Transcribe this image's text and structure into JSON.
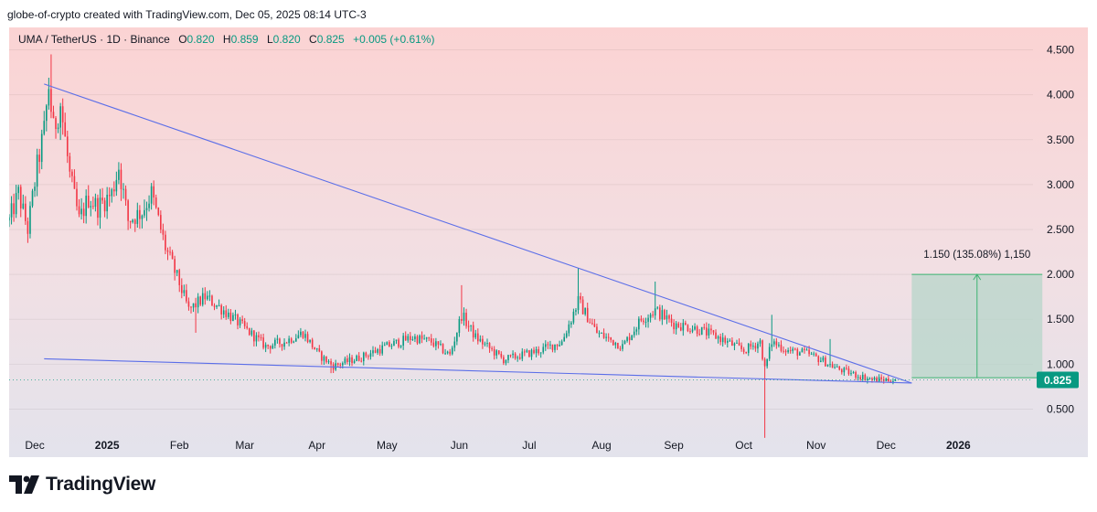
{
  "header": {
    "credit": "globe-of-crypto created with TradingView.com, Dec 05, 2025 08:14 UTC-3"
  },
  "legend": {
    "symbol": "UMA / TetherUS · 1D · Binance",
    "o_label": "O",
    "o_value": "0.820",
    "h_label": "H",
    "h_value": "0.859",
    "l_label": "L",
    "l_value": "0.820",
    "c_label": "C",
    "c_value": "0.825",
    "change": "+0.005 (+0.61%)"
  },
  "price_tag": "0.825",
  "measure_label": "1.150 (135.08%) 1,150",
  "brand": {
    "name": "TradingView"
  },
  "colors": {
    "up": "#089981",
    "down": "#f23645",
    "trendline": "#5b6ee8",
    "projection_fill": "#b7d6c9",
    "projection_stroke": "#3cb371"
  },
  "chart_data": {
    "type": "candlestick",
    "symbol": "UMA / TetherUS",
    "interval": "1D",
    "exchange": "Binance",
    "y_ticks": [
      "4.500",
      "4.000",
      "3.500",
      "3.000",
      "2.500",
      "2.000",
      "1.500",
      "1.000",
      "0.500"
    ],
    "ylim": [
      0.25,
      4.75
    ],
    "x_ticks": [
      "Dec",
      "2025",
      "Feb",
      "Mar",
      "Apr",
      "May",
      "Jun",
      "Jul",
      "Aug",
      "Sep",
      "Oct",
      "Nov",
      "Dec",
      "2026"
    ],
    "x_start": "2024-11-20",
    "x_end": "2026-02-02",
    "last_price": 0.825,
    "price_path": [
      [
        "2024-11-20",
        2.6
      ],
      [
        "2024-11-24",
        2.9
      ],
      [
        "2024-11-28",
        2.5
      ],
      [
        "2024-12-02",
        3.2
      ],
      [
        "2024-12-05",
        3.6
      ],
      [
        "2024-12-07",
        4.1
      ],
      [
        "2024-12-09",
        3.6
      ],
      [
        "2024-12-12",
        3.9
      ],
      [
        "2024-12-16",
        3.1
      ],
      [
        "2024-12-20",
        2.6
      ],
      [
        "2024-12-24",
        2.85
      ],
      [
        "2024-12-28",
        2.75
      ],
      [
        "2025-01-03",
        2.9
      ],
      [
        "2025-01-06",
        3.2
      ],
      [
        "2025-01-10",
        2.6
      ],
      [
        "2025-01-16",
        2.7
      ],
      [
        "2025-01-20",
        2.9
      ],
      [
        "2025-01-26",
        2.3
      ],
      [
        "2025-02-01",
        1.9
      ],
      [
        "2025-02-05",
        1.6
      ],
      [
        "2025-02-12",
        1.75
      ],
      [
        "2025-02-20",
        1.6
      ],
      [
        "2025-03-01",
        1.4
      ],
      [
        "2025-03-10",
        1.2
      ],
      [
        "2025-03-18",
        1.25
      ],
      [
        "2025-03-26",
        1.35
      ],
      [
        "2025-04-02",
        1.1
      ],
      [
        "2025-04-08",
        0.98
      ],
      [
        "2025-04-20",
        1.08
      ],
      [
        "2025-05-01",
        1.2
      ],
      [
        "2025-05-12",
        1.3
      ],
      [
        "2025-05-20",
        1.25
      ],
      [
        "2025-05-28",
        1.1
      ],
      [
        "2025-06-02",
        1.55
      ],
      [
        "2025-06-08",
        1.3
      ],
      [
        "2025-06-20",
        1.05
      ],
      [
        "2025-07-05",
        1.15
      ],
      [
        "2025-07-15",
        1.25
      ],
      [
        "2025-07-22",
        1.7
      ],
      [
        "2025-07-30",
        1.35
      ],
      [
        "2025-08-10",
        1.2
      ],
      [
        "2025-08-18",
        1.5
      ],
      [
        "2025-08-24",
        1.6
      ],
      [
        "2025-09-01",
        1.45
      ],
      [
        "2025-09-10",
        1.4
      ],
      [
        "2025-09-20",
        1.3
      ],
      [
        "2025-10-01",
        1.15
      ],
      [
        "2025-10-08",
        1.25
      ],
      [
        "2025-10-10",
        0.95
      ],
      [
        "2025-10-13",
        1.25
      ],
      [
        "2025-10-20",
        1.15
      ],
      [
        "2025-10-28",
        1.12
      ],
      [
        "2025-11-03",
        1.05
      ],
      [
        "2025-11-10",
        0.95
      ],
      [
        "2025-11-18",
        0.88
      ],
      [
        "2025-11-25",
        0.83
      ],
      [
        "2025-12-05",
        0.825
      ]
    ],
    "candle_highs": [
      [
        "2024-12-08",
        4.45
      ],
      [
        "2025-01-06",
        3.25
      ],
      [
        "2025-06-02",
        1.88
      ],
      [
        "2025-07-22",
        2.07
      ],
      [
        "2025-08-24",
        1.92
      ],
      [
        "2025-10-13",
        1.55
      ],
      [
        "2025-11-07",
        1.28
      ]
    ],
    "candle_lows": [
      [
        "2025-02-08",
        1.35
      ],
      [
        "2025-04-07",
        0.9
      ],
      [
        "2025-10-10",
        0.18
      ]
    ],
    "trendlines": [
      {
        "name": "descending-resistance",
        "points": [
          [
            "2024-12-05",
            4.12
          ],
          [
            "2025-12-12",
            0.79
          ]
        ]
      },
      {
        "name": "support",
        "points": [
          [
            "2024-12-05",
            1.06
          ],
          [
            "2025-12-12",
            0.79
          ]
        ]
      }
    ],
    "projection": {
      "x_range": [
        "2025-12-12",
        "2026-02-06"
      ],
      "y_range": [
        0.85,
        2.0
      ],
      "change": 1.15,
      "percent": 135.08,
      "ticks": 1150
    },
    "grid": true
  }
}
